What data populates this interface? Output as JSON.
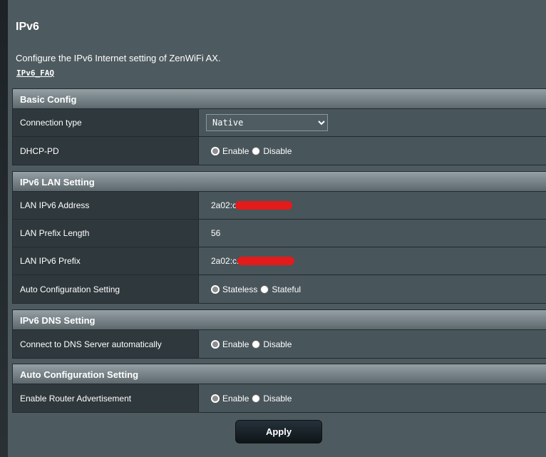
{
  "page": {
    "title": "IPv6",
    "description": "Configure the IPv6 Internet setting of ZenWiFi AX.",
    "faq_link": "IPv6_FAQ"
  },
  "basic": {
    "header": "Basic Config",
    "connection_type_label": "Connection type",
    "connection_type_value": "Native",
    "dhcp_pd_label": "DHCP-PD",
    "enable": "Enable",
    "disable": "Disable",
    "dhcp_pd_selected": "Enable"
  },
  "lan": {
    "header": "IPv6 LAN Setting",
    "address_label": "LAN IPv6 Address",
    "address_value": "2a02:c",
    "prefix_length_label": "LAN Prefix Length",
    "prefix_length_value": "56",
    "prefix_label": "LAN IPv6 Prefix",
    "prefix_value": "2a02:c.",
    "auto_label": "Auto Configuration Setting",
    "stateless": "Stateless",
    "stateful": "Stateful",
    "auto_selected": "Stateless"
  },
  "dns": {
    "header": "IPv6 DNS Setting",
    "auto_label": "Connect to DNS Server automatically",
    "enable": "Enable",
    "disable": "Disable",
    "selected": "Enable"
  },
  "autoconf": {
    "header": "Auto Configuration Setting",
    "ra_label": "Enable Router Advertisement",
    "enable": "Enable",
    "disable": "Disable",
    "selected": "Enable"
  },
  "apply_label": "Apply",
  "colors": {
    "background": "#4d5a5f",
    "redaction": "#e31b1b"
  }
}
